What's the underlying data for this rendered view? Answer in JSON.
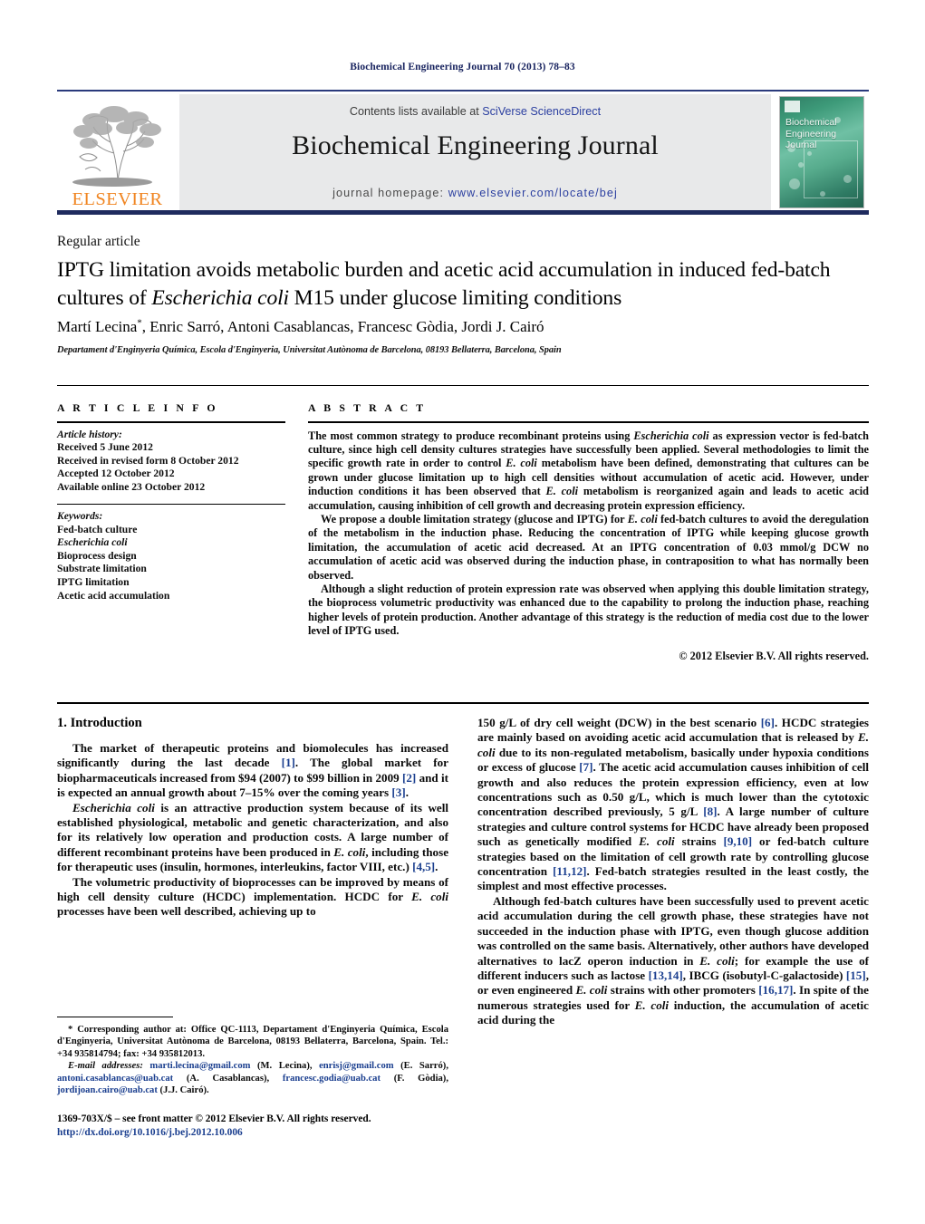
{
  "running_head": "Biochemical Engineering Journal 70 (2013) 78–83",
  "masthead": {
    "publisher_name": "ELSEVIER",
    "contents_prefix": "Contents lists available at ",
    "contents_link": "SciVerse ScienceDirect",
    "journal_name": "Biochemical Engineering Journal",
    "homepage_prefix": "journal homepage: ",
    "homepage_url": "www.elsevier.com/locate/bej",
    "cover_title_line1": "Biochemical",
    "cover_title_line2": "Engineering",
    "cover_title_line3": "Journal"
  },
  "article": {
    "type": "Regular article",
    "title_part1": "IPTG limitation avoids metabolic burden and acetic acid accumulation in induced fed-batch cultures of ",
    "title_italic": "Escherichia coli",
    "title_part2": " M15 under glucose limiting conditions",
    "authors": "Martí Lecina, Enric Sarró, Antoni Casablancas, Francesc Gòdia, Jordi J. Cairó",
    "authors_star": "*",
    "affiliation": "Departament d'Enginyeria Química, Escola d'Enginyeria, Universitat Autònoma de Barcelona, 08193 Bellaterra, Barcelona, Spain"
  },
  "info": {
    "heading": "A R T I C L E    I N F O",
    "history_label": "Article history:",
    "history": [
      "Received 5 June 2012",
      "Received in revised form 8 October 2012",
      "Accepted 12 October 2012",
      "Available online 23 October 2012"
    ],
    "keywords_label": "Keywords:",
    "keywords": [
      "Fed-batch culture",
      "Escherichia coli",
      "Bioprocess design",
      "Substrate limitation",
      "IPTG limitation",
      "Acetic acid accumulation"
    ]
  },
  "abstract": {
    "heading": "A B S T R A C T",
    "p1_a": "The most common strategy to produce recombinant proteins using ",
    "p1_italic1": "Escherichia coli",
    "p1_b": " as expression vector is fed-batch culture, since high cell density cultures strategies have successfully been applied. Several methodologies to limit the specific growth rate in order to control ",
    "p1_italic2": "E. coli",
    "p1_c": " metabolism have been defined, demonstrating that cultures can be grown under glucose limitation up to high cell densities without accumulation of acetic acid. However, under induction conditions it has been observed that ",
    "p1_italic3": "E. coli",
    "p1_d": " metabolism is reorganized again and leads to acetic acid accumulation, causing inhibition of cell growth and decreasing protein expression efficiency.",
    "p2_a": "We propose a double limitation strategy (glucose and IPTG) for ",
    "p2_italic1": "E. coli",
    "p2_b": " fed-batch cultures to avoid the deregulation of the metabolism in the induction phase. Reducing the concentration of IPTG while keeping glucose growth limitation, the accumulation of acetic acid decreased. At an IPTG concentration of 0.03 mmol/g DCW no accumulation of acetic acid was observed during the induction phase, in contraposition to what has normally been observed.",
    "p3": "Although a slight reduction of protein expression rate was observed when applying this double limitation strategy, the bioprocess volumetric productivity was enhanced due to the capability to prolong the induction phase, reaching higher levels of protein production. Another advantage of this strategy is the reduction of media cost due to the lower level of IPTG used.",
    "copyright": "© 2012 Elsevier B.V. All rights reserved."
  },
  "introduction": {
    "heading": "1.  Introduction",
    "left": {
      "p1_a": "The market of therapeutic proteins and biomolecules has increased significantly during the last decade ",
      "p1_r1": "[1]",
      "p1_b": ". The global market for biopharmaceuticals increased from $94 (2007) to $99 billion in 2009 ",
      "p1_r2": "[2]",
      "p1_c": " and it is expected an annual growth about 7–15% over the coming years ",
      "p1_r3": "[3]",
      "p1_d": ".",
      "p2_italic": "Escherichia coli",
      "p2_a": " is an attractive production system because of its well established physiological, metabolic and genetic characterization, and also for its relatively low operation and production costs. A large number of different recombinant proteins have been produced in ",
      "p2_italic2": "E. coli",
      "p2_b": ", including those for therapeutic uses (insulin, hormones, interleukins, factor VIII, etc.) ",
      "p2_r1": "[4,5]",
      "p2_c": ".",
      "p3_a": "The volumetric productivity of bioprocesses can be improved by means of high cell density culture (HCDC) implementation. HCDC for ",
      "p3_italic": "E. coli",
      "p3_b": " processes have been well described, achieving up to"
    },
    "right": {
      "p1_a": "150 g/L of dry cell weight (DCW) in the best scenario ",
      "p1_r1": "[6]",
      "p1_b": ". HCDC strategies are mainly based on avoiding acetic acid accumulation that is released by ",
      "p1_italic1": "E. coli",
      "p1_c": " due to its non-regulated metabolism, basically under hypoxia conditions or excess of glucose ",
      "p1_r2": "[7]",
      "p1_d": ". The acetic acid accumulation causes inhibition of cell growth and also reduces the protein expression efficiency, even at low concentrations such as 0.50 g/L, which is much lower than the cytotoxic concentration described previously, 5 g/L ",
      "p1_r3": "[8]",
      "p1_e": ". A large number of culture strategies and culture control systems for HCDC have already been proposed such as genetically modified ",
      "p1_italic2": "E. coli",
      "p1_f": " strains ",
      "p1_r4": "[9,10]",
      "p1_g": " or fed-batch culture strategies based on the limitation of cell growth rate by controlling glucose concentration ",
      "p1_r5": "[11,12]",
      "p1_h": ". Fed-batch strategies resulted in the least costly, the simplest and most effective processes.",
      "p2_a": "Although fed-batch cultures have been successfully used to prevent acetic acid accumulation during the cell growth phase, these strategies have not succeeded in the induction phase with IPTG, even though glucose addition was controlled on the same basis. Alternatively, other authors have developed alternatives to lacZ operon induction in ",
      "p2_italic1": "E. coli",
      "p2_b": "; for example the use of different inducers such as lactose ",
      "p2_r1": "[13,14]",
      "p2_c": ", IBCG (isobutyl-C-galactoside) ",
      "p2_r2": "[15]",
      "p2_d": ", or even engineered ",
      "p2_italic2": "E. coli",
      "p2_e": " strains with other promoters ",
      "p2_r3": "[16,17]",
      "p2_f": ". In spite of the numerous strategies used for ",
      "p2_italic3": "E. coli",
      "p2_g": " induction, the accumulation of acetic acid during the"
    }
  },
  "footnotes": {
    "corresponding": "* Corresponding author at: Office QC-1113, Departament d'Enginyeria Química, Escola d'Enginyeria, Universitat Autònoma de Barcelona, 08193 Bellaterra, Barcelona, Spain. Tel.: +34 935814794; fax: +34 935812013.",
    "email_label": "E-mail addresses:",
    "email1": "marti.lecina@gmail.com",
    "email1_owner": " (M. Lecina), ",
    "email2": "enrisj@gmail.com",
    "email2_owner": " (E. Sarró), ",
    "email3": "antoni.casablancas@uab.cat",
    "email3_owner": " (A. Casablancas), ",
    "email4": "francesc.godia@uab.cat",
    "email4_owner": " (F. Gòdia), ",
    "email5": "jordijoan.cairo@uab.cat",
    "email5_owner": " (J.J. Cairó)."
  },
  "imprint": {
    "issn_line": "1369-703X/$ – see front matter © 2012 Elsevier B.V. All rights reserved.",
    "doi": "http://dx.doi.org/10.1016/j.bej.2012.10.006"
  },
  "colors": {
    "link_blue": "#2b3fa0",
    "ref_blue": "#1b3f8f",
    "elsevier_orange": "#F08521",
    "masthead_navy": "#1f2b5e",
    "panel_gray": "#e8e9ea"
  }
}
